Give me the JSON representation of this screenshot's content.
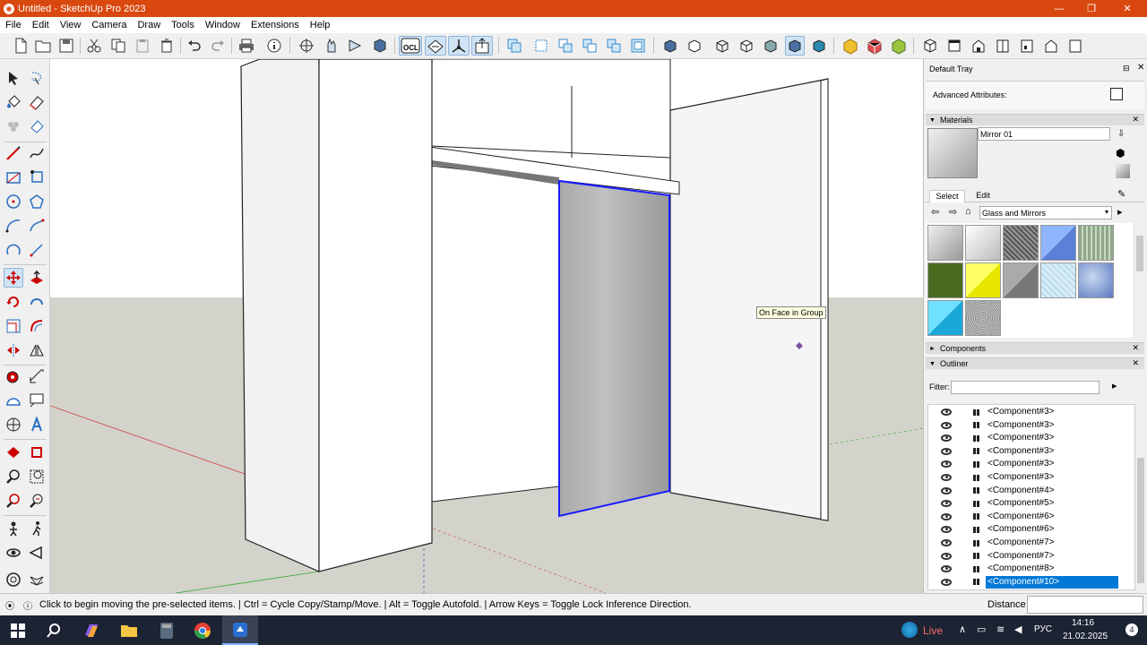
{
  "window": {
    "title": "Untitled - SketchUp Pro 2023",
    "minimize": "—",
    "restore": "❐",
    "close": "✕"
  },
  "menu": [
    "File",
    "Edit",
    "View",
    "Camera",
    "Draw",
    "Tools",
    "Window",
    "Extensions",
    "Help"
  ],
  "toolbar": {
    "ocl_label": "OCL"
  },
  "viewport": {
    "tooltip": "On Face in Group"
  },
  "tray": {
    "title": "Default Tray",
    "advanced_attributes": "Advanced Attributes:",
    "materials": {
      "header": "Materials",
      "name": "Mirror 01",
      "tabs": [
        "Select",
        "Edit"
      ],
      "library": "Glass and Mirrors",
      "swatches": [
        {
          "color": "#b8b8b8",
          "style": "mirror"
        },
        {
          "color": "#d8d8d8",
          "style": "mirror-light"
        },
        {
          "color": "#6a6a6a",
          "style": "texture"
        },
        {
          "color": "#6f96e8",
          "style": "blue"
        },
        {
          "color": "#9fb59a",
          "style": "green-lines"
        },
        {
          "color": "#4a6b1f",
          "style": "green-dark"
        },
        {
          "color": "#ffff33",
          "style": "yellow"
        },
        {
          "color": "#8a8a8a",
          "style": "gray"
        },
        {
          "color": "#cfe8f3",
          "style": "ice"
        },
        {
          "color": "#8aa3d6",
          "style": "cloud"
        },
        {
          "color": "#2bc4ee",
          "style": "cyan"
        },
        {
          "color": "#b0b0b0",
          "style": "noise"
        }
      ]
    },
    "components_header": "Components",
    "outliner": {
      "header": "Outliner",
      "filter_label": "Filter:",
      "filter_value": "",
      "rows": [
        {
          "name": "<Component#3>",
          "selected": false
        },
        {
          "name": "<Component#3>",
          "selected": false
        },
        {
          "name": "<Component#3>",
          "selected": false
        },
        {
          "name": "<Component#3>",
          "selected": false
        },
        {
          "name": "<Component#3>",
          "selected": false
        },
        {
          "name": "<Component#3>",
          "selected": false
        },
        {
          "name": "<Component#4>",
          "selected": false
        },
        {
          "name": "<Component#5>",
          "selected": false
        },
        {
          "name": "<Component#6>",
          "selected": false
        },
        {
          "name": "<Component#6>",
          "selected": false
        },
        {
          "name": "<Component#7>",
          "selected": false
        },
        {
          "name": "<Component#7>",
          "selected": false
        },
        {
          "name": "<Component#8>",
          "selected": false
        },
        {
          "name": "<Component#10>",
          "selected": true
        }
      ]
    }
  },
  "statusbar": {
    "message": "Click to begin moving the pre-selected items. | Ctrl = Cycle Copy/Stamp/Move. | Alt = Toggle Autofold. | Arrow Keys = Toggle Lock Inference Direction.",
    "measure_label": "Distance",
    "measure_value": ""
  },
  "taskbar": {
    "weather": "Live",
    "language": "РУС",
    "time": "14:16",
    "date": "21.02.2025",
    "notifications": "4"
  },
  "colors": {
    "titlebar": "#d9480f",
    "selection": "#0078d7",
    "taskbar": "#1c2333"
  }
}
